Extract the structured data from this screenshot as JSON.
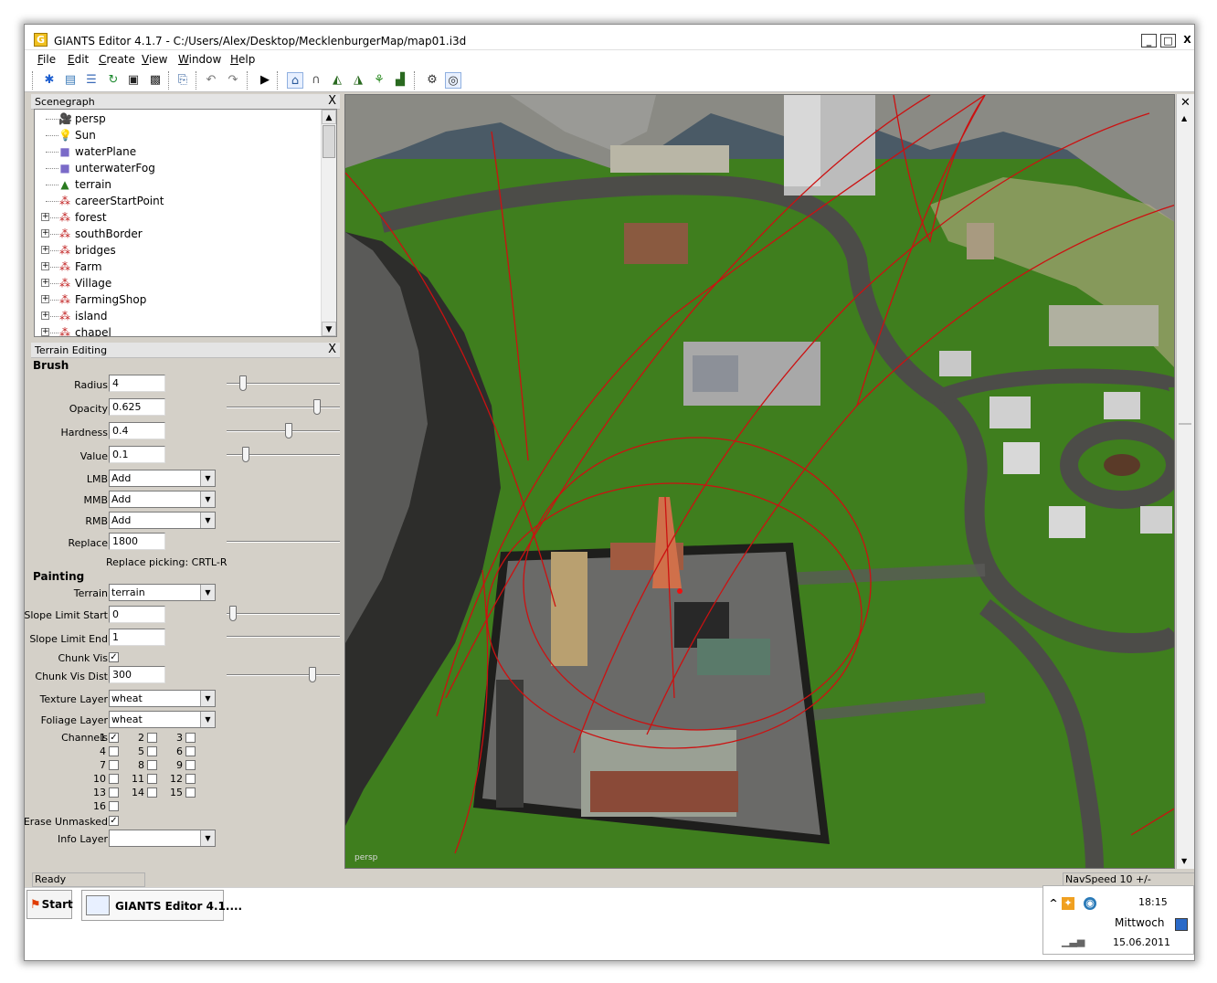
{
  "window": {
    "title": "GIANTS Editor 4.1.7 - C:/Users/Alex/Desktop/MecklenburgerMap/map01.i3d",
    "app_icon": "G",
    "min": "_",
    "max": "□",
    "close": "X"
  },
  "menu": [
    "File",
    "Edit",
    "Create",
    "View",
    "Window",
    "Help"
  ],
  "toolbar": {
    "icons": [
      "new-icon",
      "open-icon",
      "properties-icon",
      "refresh-icon",
      "save-icon",
      "save-as-icon",
      "import-icon",
      "undo-icon",
      "redo-icon",
      "play-icon",
      "home-icon",
      "magnet-icon",
      "terrain-sculpt-icon",
      "terrain-paint-icon",
      "foliage-icon",
      "terrain-height-icon",
      "render-settings-icon",
      "render-mode-icon"
    ]
  },
  "scenegraph": {
    "title": "Scenegraph",
    "close": "X",
    "items": [
      {
        "label": "persp",
        "icon": "camera-icon",
        "glyph": "🎥",
        "expandable": false
      },
      {
        "label": "Sun",
        "icon": "light-bulb-icon",
        "glyph": "💡",
        "expandable": false
      },
      {
        "label": "waterPlane",
        "icon": "cube-icon",
        "glyph": "■",
        "expandable": false
      },
      {
        "label": "unterwaterFog",
        "icon": "cube-icon",
        "glyph": "■",
        "expandable": false
      },
      {
        "label": "terrain",
        "icon": "terrain-icon",
        "glyph": "▲",
        "expandable": false
      },
      {
        "label": "careerStartPoint",
        "icon": "transform-group-icon",
        "glyph": "⁂",
        "expandable": false
      },
      {
        "label": "forest",
        "icon": "transform-group-icon",
        "glyph": "⁂",
        "expandable": true
      },
      {
        "label": "southBorder",
        "icon": "transform-group-icon",
        "glyph": "⁂",
        "expandable": true
      },
      {
        "label": "bridges",
        "icon": "transform-group-icon",
        "glyph": "⁂",
        "expandable": true
      },
      {
        "label": "Farm",
        "icon": "transform-group-icon",
        "glyph": "⁂",
        "expandable": true
      },
      {
        "label": "Village",
        "icon": "transform-group-icon",
        "glyph": "⁂",
        "expandable": true
      },
      {
        "label": "FarmingShop",
        "icon": "transform-group-icon",
        "glyph": "⁂",
        "expandable": true
      },
      {
        "label": "island",
        "icon": "transform-group-icon",
        "glyph": "⁂",
        "expandable": true
      },
      {
        "label": "chapel",
        "icon": "transform-group-icon",
        "glyph": "⁂",
        "expandable": true
      }
    ]
  },
  "terrain_editing": {
    "title": "Terrain Editing",
    "close": "X",
    "brush_section": "Brush",
    "radius": {
      "label": "Radius",
      "value": "4",
      "slider": 0.12
    },
    "opacity": {
      "label": "Opacity",
      "value": "0.625",
      "slider": 0.82
    },
    "hardness": {
      "label": "Hardness",
      "value": "0.4",
      "slider": 0.55
    },
    "value": {
      "label": "Value",
      "value": "0.1",
      "slider": 0.15
    },
    "lmb": {
      "label": "LMB",
      "value": "Add"
    },
    "mmb": {
      "label": "MMB",
      "value": "Add"
    },
    "rmb": {
      "label": "RMB",
      "value": "Add"
    },
    "replace": {
      "label": "Replace",
      "value": "1800"
    },
    "replace_picking": "Replace picking: CRTL-R",
    "painting_section": "Painting",
    "terrain": {
      "label": "Terrain",
      "value": "terrain"
    },
    "slope_limit_start": {
      "label": "Slope Limit Start",
      "value": "0",
      "slider": 0.03
    },
    "slope_limit_end": {
      "label": "Slope Limit End",
      "value": "1"
    },
    "chunk_vis": {
      "label": "Chunk Vis",
      "checked": true
    },
    "chunk_vis_dist": {
      "label": "Chunk Vis Dist",
      "value": "300",
      "slider": 0.78
    },
    "texture_layer": {
      "label": "Texture Layer",
      "value": "wheat"
    },
    "foliage_layer": {
      "label": "Foliage Layer",
      "value": "wheat"
    },
    "channels_label": "Channels",
    "channels": [
      {
        "n": "1",
        "checked": true
      },
      {
        "n": "2",
        "checked": false
      },
      {
        "n": "3",
        "checked": false
      },
      {
        "n": "4",
        "checked": false
      },
      {
        "n": "5",
        "checked": false
      },
      {
        "n": "6",
        "checked": false
      },
      {
        "n": "7",
        "checked": false
      },
      {
        "n": "8",
        "checked": false
      },
      {
        "n": "9",
        "checked": false
      },
      {
        "n": "10",
        "checked": false
      },
      {
        "n": "11",
        "checked": false
      },
      {
        "n": "12",
        "checked": false
      },
      {
        "n": "13",
        "checked": false
      },
      {
        "n": "14",
        "checked": false
      },
      {
        "n": "15",
        "checked": false
      },
      {
        "n": "16",
        "checked": false
      }
    ],
    "erase_unmasked": {
      "label": "Erase Unmasked",
      "checked": true
    },
    "info_layer": {
      "label": "Info Layer",
      "value": ""
    }
  },
  "status": {
    "left": "Ready",
    "navspeed": "NavSpeed 10 +/-"
  },
  "viewport": {
    "camera_label": "persp"
  },
  "taskbar": {
    "start": "Start",
    "task": "GIANTS Editor 4.1....",
    "time": "18:15",
    "day": "Mittwoch",
    "date": "15.06.2011"
  },
  "colors": {
    "grass": "#3e7d1c",
    "road": "#4c4c48",
    "gizmo": "#cc1111",
    "rock": "#7a7a78"
  }
}
